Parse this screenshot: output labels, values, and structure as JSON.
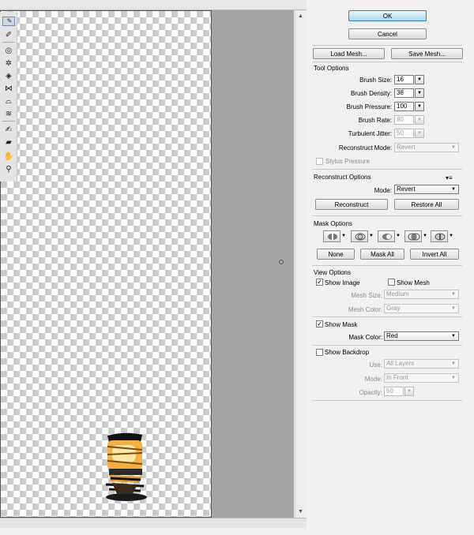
{
  "buttons": {
    "ok": "OK",
    "cancel": "Cancel",
    "load_mesh": "Load Mesh...",
    "save_mesh": "Save Mesh..."
  },
  "tool_options": {
    "title": "Tool Options",
    "brush_size": {
      "label": "Brush Size:",
      "value": "16"
    },
    "brush_density": {
      "label": "Brush Density:",
      "value": "38"
    },
    "brush_pressure": {
      "label": "Brush Pressure:",
      "value": "100"
    },
    "brush_rate": {
      "label": "Brush Rate:",
      "value": "80"
    },
    "turbulent_jitter": {
      "label": "Turbulent Jitter:",
      "value": "50"
    },
    "reconstruct_mode": {
      "label": "Reconstruct Mode:",
      "value": "Revert"
    },
    "stylus_pressure": "Stylus Pressure"
  },
  "reconstruct_options": {
    "title": "Reconstruct Options",
    "mode_label": "Mode:",
    "mode_value": "Revert",
    "reconstruct": "Reconstruct",
    "restore_all": "Restore All"
  },
  "mask_options": {
    "title": "Mask Options",
    "none": "None",
    "mask_all": "Mask All",
    "invert_all": "Invert All"
  },
  "view_options": {
    "title": "View Options",
    "show_image": "Show Image",
    "show_mesh": "Show Mesh",
    "mesh_size_label": "Mesh Size:",
    "mesh_size_value": "Medium",
    "mesh_color_label": "Mesh Color:",
    "mesh_color_value": "Gray",
    "show_mask": "Show Mask",
    "mask_color_label": "Mask Color:",
    "mask_color_value": "Red",
    "show_backdrop": "Show Backdrop",
    "use_label": "Use:",
    "use_value": "All Layers",
    "mode_label": "Mode:",
    "mode_value": "In Front",
    "opacity_label": "Opacity:",
    "opacity_value": "50"
  },
  "state": {
    "show_image_checked": true,
    "show_mesh_checked": false,
    "show_mask_checked": true,
    "show_backdrop_checked": false,
    "stylus_pressure_checked": false
  },
  "icons": [
    "forward-warp-tool-icon",
    "reconstruct-tool-icon",
    "twirl-clockwise-tool-icon",
    "pucker-tool-icon",
    "bloat-tool-icon",
    "push-left-tool-icon",
    "mirror-tool-icon",
    "turbulence-tool-icon",
    "freeze-mask-tool-icon",
    "thaw-mask-tool-icon",
    "hand-tool-icon",
    "zoom-tool-icon"
  ]
}
